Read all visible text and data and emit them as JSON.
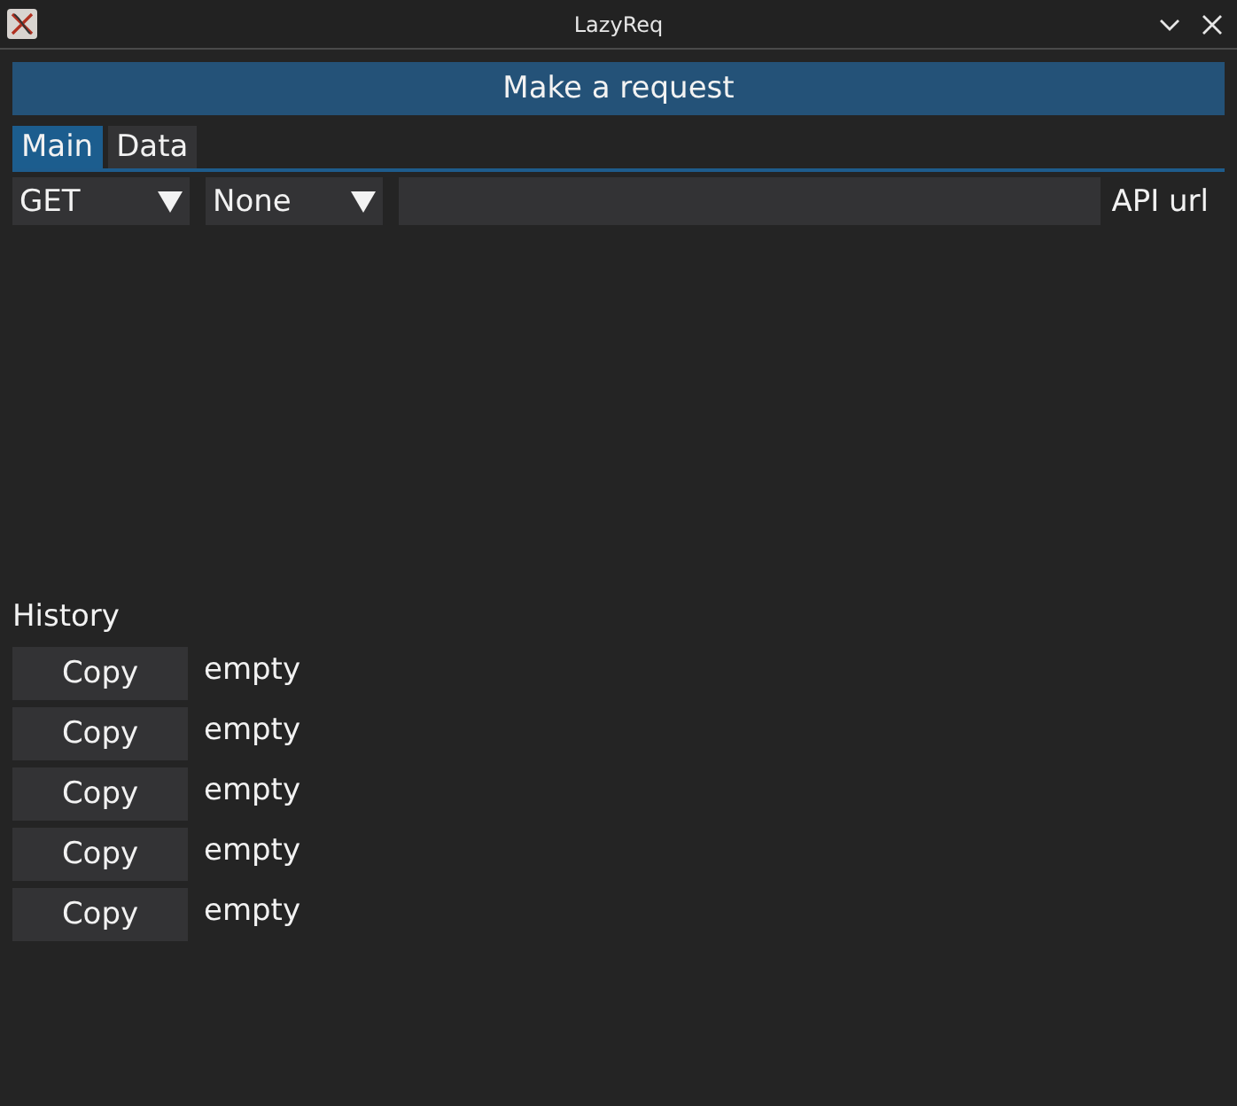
{
  "window": {
    "title": "LazyReq"
  },
  "request_button": {
    "label": "Make a request"
  },
  "tabs": [
    {
      "label": "Main",
      "selected": true
    },
    {
      "label": "Data",
      "selected": false
    }
  ],
  "request_row": {
    "method": {
      "value": "GET"
    },
    "auth": {
      "value": "None"
    },
    "url": {
      "label": "API url"
    }
  },
  "history": {
    "title": "History",
    "items": [
      {
        "button": "Copy",
        "text": "empty"
      },
      {
        "button": "Copy",
        "text": "empty"
      },
      {
        "button": "Copy",
        "text": "empty"
      },
      {
        "button": "Copy",
        "text": "empty"
      },
      {
        "button": "Copy",
        "text": "empty"
      }
    ]
  }
}
